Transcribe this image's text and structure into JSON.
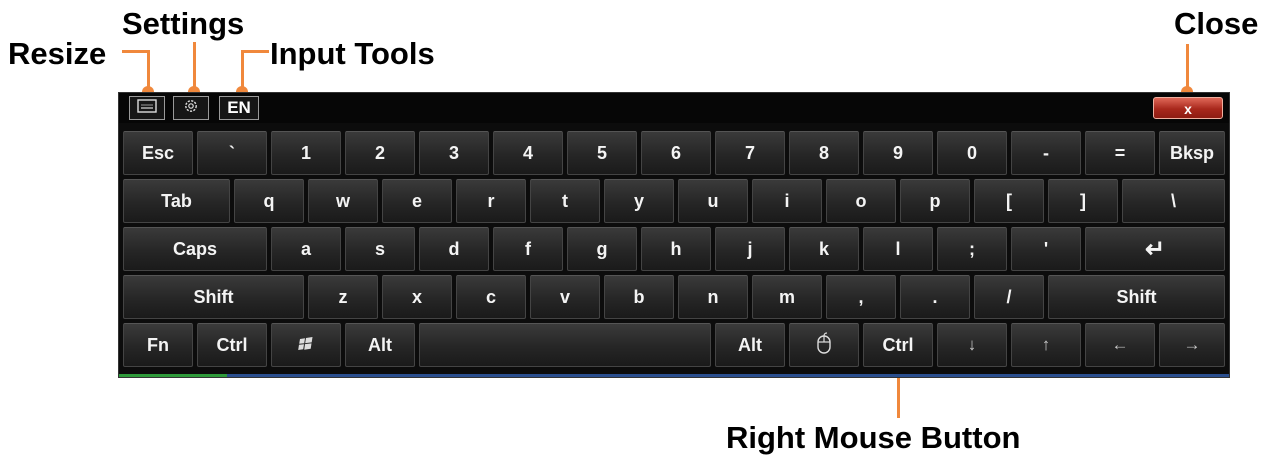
{
  "callouts": {
    "resize": "Resize",
    "settings": "Settings",
    "input_tools": "Input Tools",
    "close": "Close",
    "right_mouse_button": "Right Mouse Button"
  },
  "titlebar": {
    "resize_icon": "keyboard-resize-icon",
    "settings_icon": "gear-icon",
    "language": "EN",
    "close_label": "x"
  },
  "keys": {
    "row1": [
      "Esc",
      "`",
      "1",
      "2",
      "3",
      "4",
      "5",
      "6",
      "7",
      "8",
      "9",
      "0",
      "-",
      "=",
      "Bksp"
    ],
    "row2": [
      "Tab",
      "q",
      "w",
      "e",
      "r",
      "t",
      "y",
      "u",
      "i",
      "o",
      "p",
      "[",
      "]",
      "\\"
    ],
    "row3": [
      "Caps",
      "a",
      "s",
      "d",
      "f",
      "g",
      "h",
      "j",
      "k",
      "l",
      ";",
      "'",
      "↵"
    ],
    "row4": [
      "Shift",
      "z",
      "x",
      "c",
      "v",
      "b",
      "n",
      "m",
      ",",
      ".",
      "/",
      "Shift"
    ],
    "row5": {
      "fn": "Fn",
      "ctrl_left": "Ctrl",
      "win_icon": "windows-logo-icon",
      "alt_left": "Alt",
      "space": "",
      "alt_right": "Alt",
      "mouse_icon": "mouse-icon",
      "ctrl_right": "Ctrl",
      "down": "↓",
      "up": "↑",
      "left": "←",
      "right": "→"
    }
  },
  "colors": {
    "callout_accent": "#f0883c",
    "keyboard_bg": "#0c0c0c",
    "close_button": "#b0281c"
  }
}
